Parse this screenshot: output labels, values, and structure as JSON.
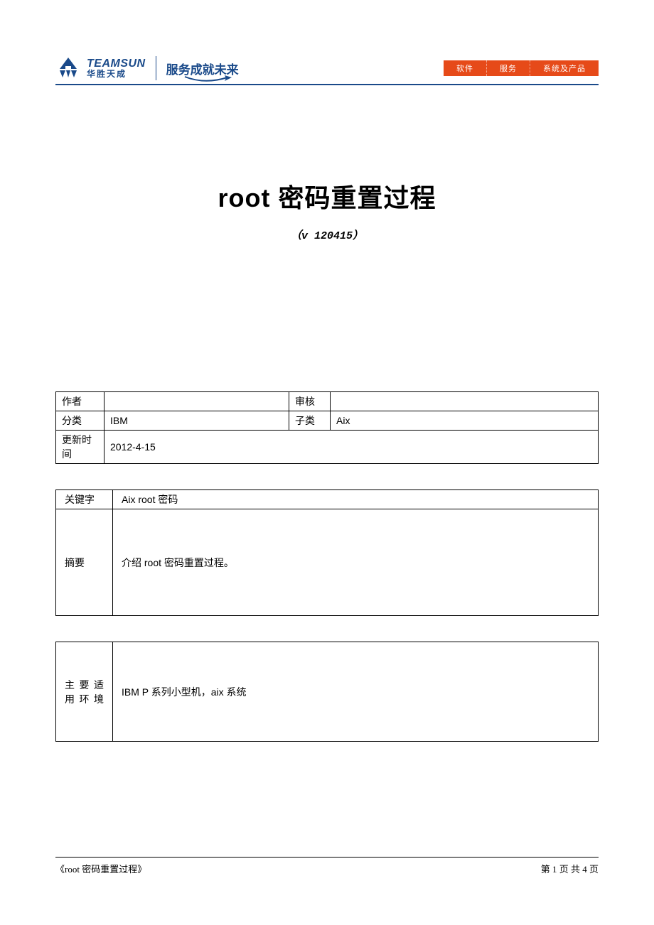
{
  "header": {
    "logo_en": "TEAMSUN",
    "logo_cn": "华胜天成",
    "slogan": "服务成就未来",
    "nav": [
      "软件",
      "服务",
      "系统及产品"
    ]
  },
  "title": "root 密码重置过程",
  "version": "（v 120415）",
  "meta": {
    "author_label": "作者",
    "author_value": "",
    "review_label": "审核",
    "review_value": "",
    "category_label": "分类",
    "category_value": "IBM",
    "subcategory_label": "子类",
    "subcategory_value": "Aix",
    "updated_label": "更新时间",
    "updated_value": "2012-4-15"
  },
  "keywords": {
    "label": "关键字",
    "value": "Aix root 密码"
  },
  "abstract": {
    "label": "摘要",
    "value": "介绍 root 密码重置过程。"
  },
  "env": {
    "label": "主 要 适用环境",
    "value": "IBM P 系列小型机，aix 系统"
  },
  "footer": {
    "left": "《root 密码重置过程》",
    "right": "第 1 页 共 4 页"
  }
}
